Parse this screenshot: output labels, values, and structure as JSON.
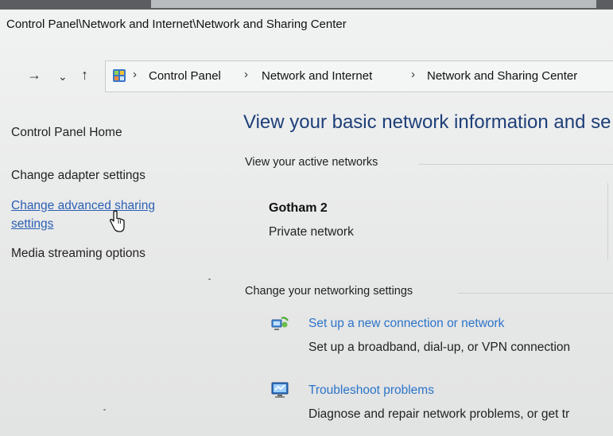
{
  "window": {
    "title": "Control Panel\\Network and Internet\\Network and Sharing Center"
  },
  "nav": {
    "forward_glyph": "→",
    "dropdown_glyph": "⌄",
    "up_glyph": "↑",
    "breadcrumb": [
      "Control Panel",
      "Network and Internet",
      "Network and Sharing Center"
    ],
    "separator": "›"
  },
  "sidebar": {
    "home": "Control Panel Home",
    "adapter": "Change adapter settings",
    "advanced_line1": "Change advanced sharing",
    "advanced_line2": "settings",
    "media": "Media streaming options"
  },
  "main": {
    "title": "View your basic network information and se",
    "active_header": "View your active networks",
    "network_name": "Gotham 2",
    "network_type": "Private network",
    "settings_header": "Change your networking settings",
    "options": [
      {
        "icon": "new-connection-icon",
        "label": "Set up a new connection or network",
        "desc": "Set up a broadband, dial-up, or VPN connection"
      },
      {
        "icon": "troubleshoot-icon",
        "label": "Troubleshoot problems",
        "desc": "Diagnose and repair network problems, or get tr"
      }
    ]
  },
  "colors": {
    "link": "#2b5fb3",
    "option_link": "#2b74c9",
    "title": "#1e3f78"
  }
}
